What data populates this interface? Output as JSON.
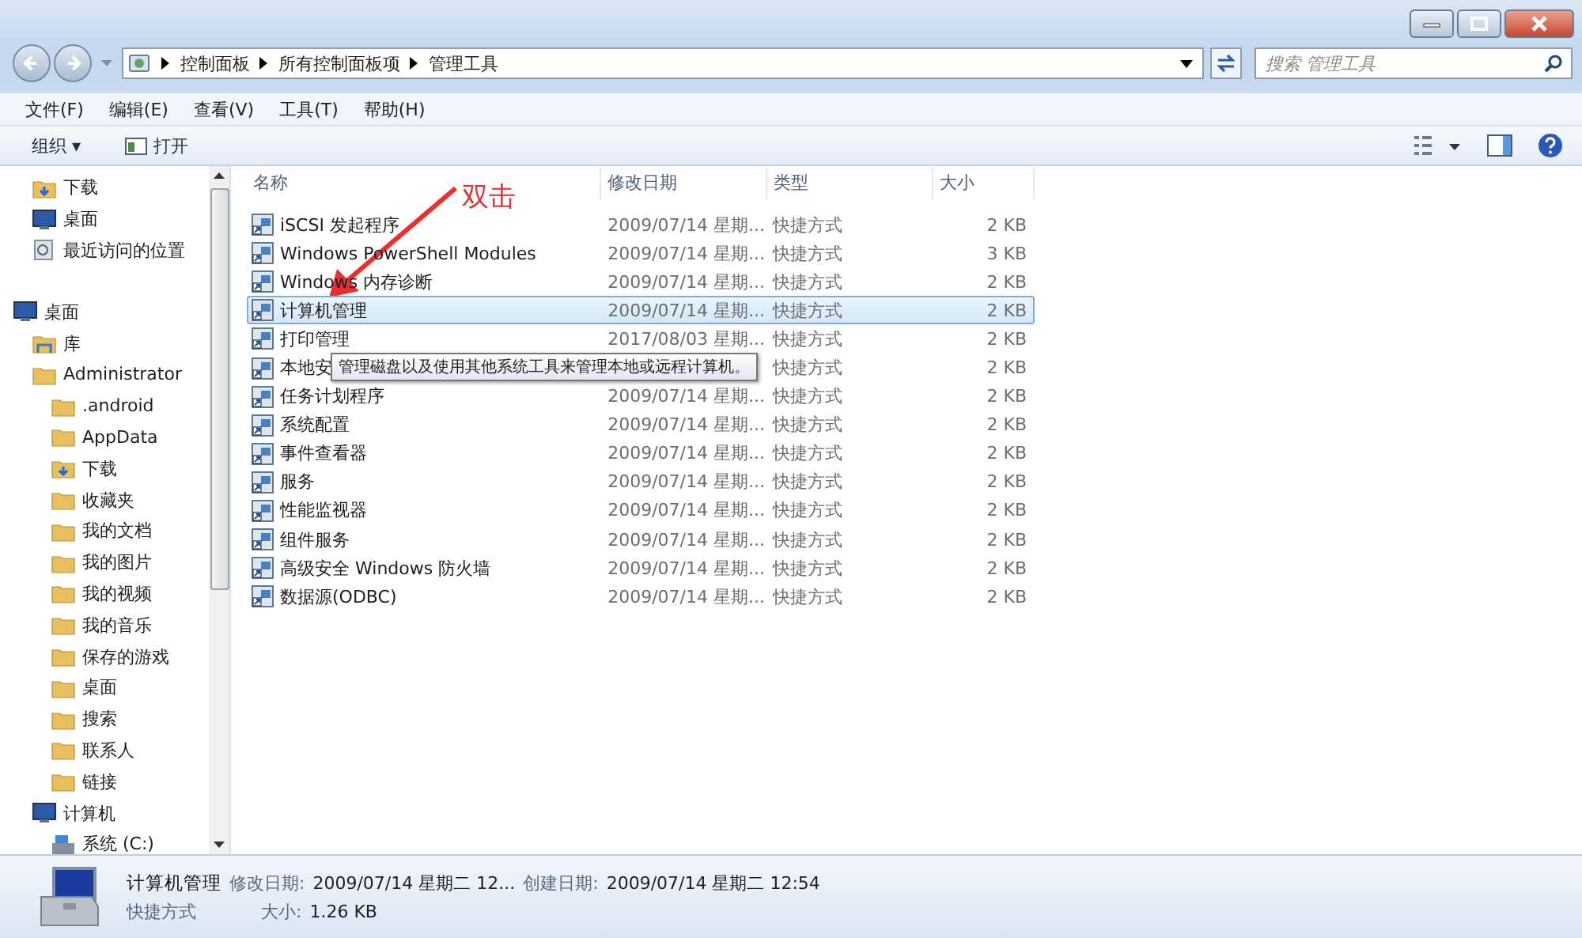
{
  "address": {
    "crumbs": [
      "控制面板",
      "所有控制面板项",
      "管理工具"
    ]
  },
  "search": {
    "placeholder": "搜索 管理工具"
  },
  "menu": [
    "文件(F)",
    "编辑(E)",
    "查看(V)",
    "工具(T)",
    "帮助(H)"
  ],
  "toolbar": {
    "organize": "组织 ▾",
    "open": "打开"
  },
  "sidebar": {
    "tree": [
      {
        "children": [
          {
            "label": "下载",
            "kind": "download"
          },
          {
            "label": "桌面",
            "kind": "desktop"
          },
          {
            "label": "最近访问的位置",
            "kind": "recent"
          }
        ]
      },
      {
        "label": "桌面",
        "kind": "desktop",
        "children": [
          {
            "label": "库",
            "kind": "library"
          },
          {
            "label": "Administrator",
            "kind": "user",
            "children": [
              {
                "label": ".android",
                "kind": "folder"
              },
              {
                "label": "AppData",
                "kind": "folder"
              },
              {
                "label": "下载",
                "kind": "download"
              },
              {
                "label": "收藏夹",
                "kind": "folder"
              },
              {
                "label": "我的文档",
                "kind": "folder"
              },
              {
                "label": "我的图片",
                "kind": "folder"
              },
              {
                "label": "我的视频",
                "kind": "folder"
              },
              {
                "label": "我的音乐",
                "kind": "folder"
              },
              {
                "label": "保存的游戏",
                "kind": "folder"
              },
              {
                "label": "桌面",
                "kind": "folder"
              },
              {
                "label": "搜索",
                "kind": "folder"
              },
              {
                "label": "联系人",
                "kind": "folder"
              },
              {
                "label": "链接",
                "kind": "folder"
              }
            ]
          },
          {
            "label": "计算机",
            "kind": "computer",
            "children": [
              {
                "label": "系统 (C:)",
                "kind": "drive"
              }
            ]
          }
        ]
      }
    ]
  },
  "table": {
    "columns": [
      "名称",
      "修改日期",
      "类型",
      "大小"
    ],
    "rows": [
      {
        "name": "iSCSI 发起程序",
        "date": "2009/07/14 星期...",
        "type": "快捷方式",
        "size": "2 KB",
        "selected": false
      },
      {
        "name": "Windows PowerShell Modules",
        "date": "2009/07/14 星期...",
        "type": "快捷方式",
        "size": "3 KB",
        "selected": false
      },
      {
        "name": "Windows 内存诊断",
        "date": "2009/07/14 星期...",
        "type": "快捷方式",
        "size": "2 KB",
        "selected": false
      },
      {
        "name": "计算机管理",
        "date": "2009/07/14 星期...",
        "type": "快捷方式",
        "size": "2 KB",
        "selected": true
      },
      {
        "name": "打印管理",
        "date": "2017/08/03 星期...",
        "type": "快捷方式",
        "size": "2 KB",
        "selected": false
      },
      {
        "name": "本地安",
        "type": "快捷方式",
        "size": "2 KB",
        "selected": false
      },
      {
        "name": "任务计划程序",
        "date": "2009/07/14 星期...",
        "type": "快捷方式",
        "size": "2 KB",
        "selected": false
      },
      {
        "name": "系统配置",
        "date": "2009/07/14 星期...",
        "type": "快捷方式",
        "size": "2 KB",
        "selected": false
      },
      {
        "name": "事件查看器",
        "date": "2009/07/14 星期...",
        "type": "快捷方式",
        "size": "2 KB",
        "selected": false
      },
      {
        "name": "服务",
        "date": "2009/07/14 星期...",
        "type": "快捷方式",
        "size": "2 KB",
        "selected": false
      },
      {
        "name": "性能监视器",
        "date": "2009/07/14 星期...",
        "type": "快捷方式",
        "size": "2 KB",
        "selected": false
      },
      {
        "name": "组件服务",
        "date": "2009/07/14 星期...",
        "type": "快捷方式",
        "size": "2 KB",
        "selected": false
      },
      {
        "name": "高级安全 Windows 防火墙",
        "date": "2009/07/14 星期...",
        "type": "快捷方式",
        "size": "2 KB",
        "selected": false
      },
      {
        "name": "数据源(ODBC)",
        "date": "2009/07/14 星期...",
        "type": "快捷方式",
        "size": "2 KB",
        "selected": false
      }
    ]
  },
  "tooltip": "管理磁盘以及使用其他系统工具来管理本地或远程计算机。",
  "annotation": {
    "text": "双击"
  },
  "details": {
    "name": "计算机管理",
    "modified_label": "修改日期:",
    "modified": "2009/07/14 星期二 12...",
    "created_label": "创建日期:",
    "created": "2009/07/14 星期二 12:54",
    "type": "快捷方式",
    "size_label": "大小:",
    "size": "1.26 KB"
  }
}
